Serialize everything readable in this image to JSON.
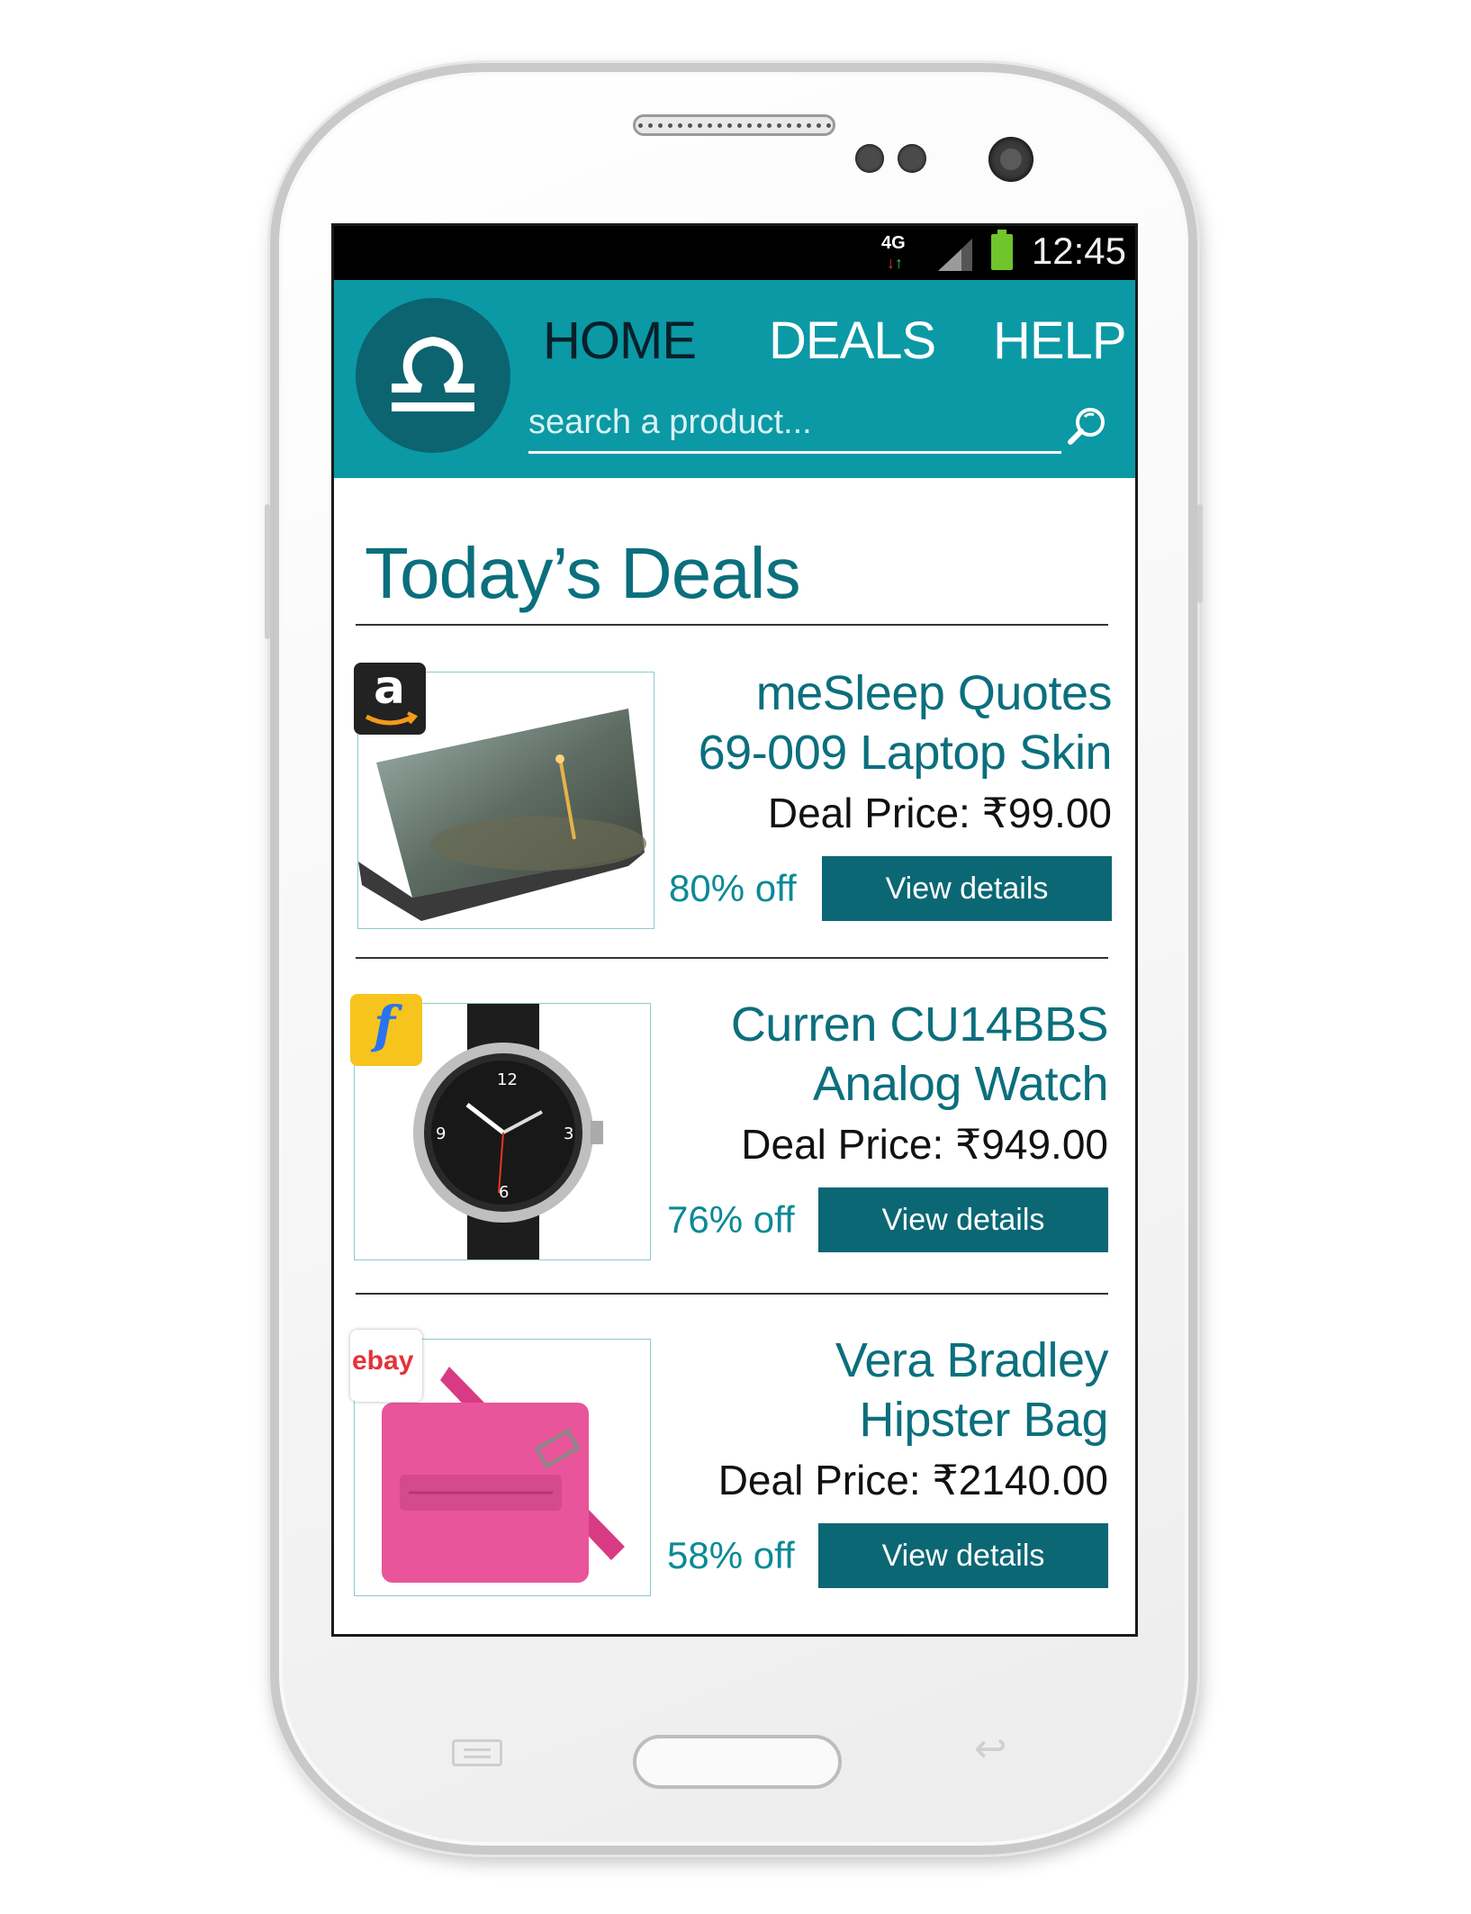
{
  "status_bar": {
    "network": "4G",
    "time": "12:45"
  },
  "header": {
    "nav": [
      {
        "label": "HOME",
        "active": true
      },
      {
        "label": "DEALS",
        "active": false
      },
      {
        "label": "HELP",
        "active": false
      }
    ],
    "search": {
      "placeholder": "search a product...",
      "value": ""
    },
    "colors": {
      "bar": "#0b99a5",
      "logo": "#0b6470",
      "active_nav": "#08202a"
    }
  },
  "main": {
    "title": "Today’s Deals",
    "deals": [
      {
        "store": "amazon",
        "name_line1": "meSleep Quotes",
        "name_line2": "69-009 Laptop Skin",
        "price": "Deal Price: ₹99.00",
        "discount": "80% off",
        "button": "View details"
      },
      {
        "store": "flipkart",
        "name_line1": "Curren CU14BBS",
        "name_line2": "Analog Watch",
        "price": "Deal Price: ₹949.00",
        "discount": "76% off",
        "button": "View details"
      },
      {
        "store": "ebay",
        "name_line1": "Vera Bradley",
        "name_line2": "Hipster Bag",
        "price": "Deal Price: ₹2140.00",
        "discount": "58% off",
        "button": "View details"
      }
    ],
    "store_logo_text": {
      "amazon": "a",
      "flipkart": "f",
      "ebay": "ebay"
    }
  },
  "colors": {
    "accent_dark": "#0b6774",
    "title_teal": "#0b6f7d",
    "discount_teal": "#0b8a96"
  }
}
